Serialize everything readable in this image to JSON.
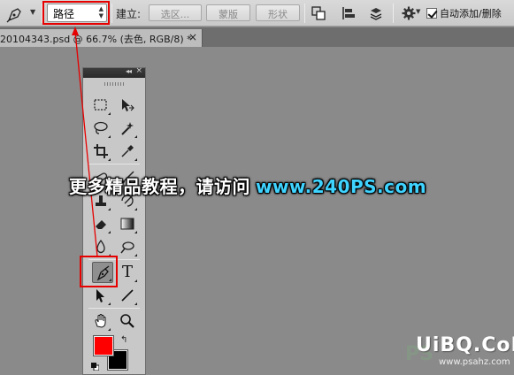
{
  "options_bar": {
    "mode_value": "路径",
    "make_label": "建立:",
    "selection_button": "选区...",
    "mask_button": "蒙版",
    "shape_button": "形状",
    "auto_add_delete_label": "自动添加/删除",
    "auto_add_delete_checked": true
  },
  "document_tab": {
    "title": "20104343.psd @ 66.7% (去色, RGB/8) *",
    "close_glyph": "×"
  },
  "tools_panel": {
    "collapse_glyph": "◂◂",
    "close_glyph": "×",
    "foreground_color": "#ff0000",
    "background_color": "#000000",
    "active_tool": "pen-tool",
    "type_tool_glyph": "T"
  },
  "overlay": {
    "banner_text": "更多精品教程，请访问",
    "banner_url": "www.240PS.com",
    "watermark": "UiBQ.CoM",
    "watermark_sub": "www.psahz.com",
    "watermark_faint": "PS"
  },
  "colors": {
    "highlight": "#e60000",
    "banner_url": "#3fd3ff"
  }
}
